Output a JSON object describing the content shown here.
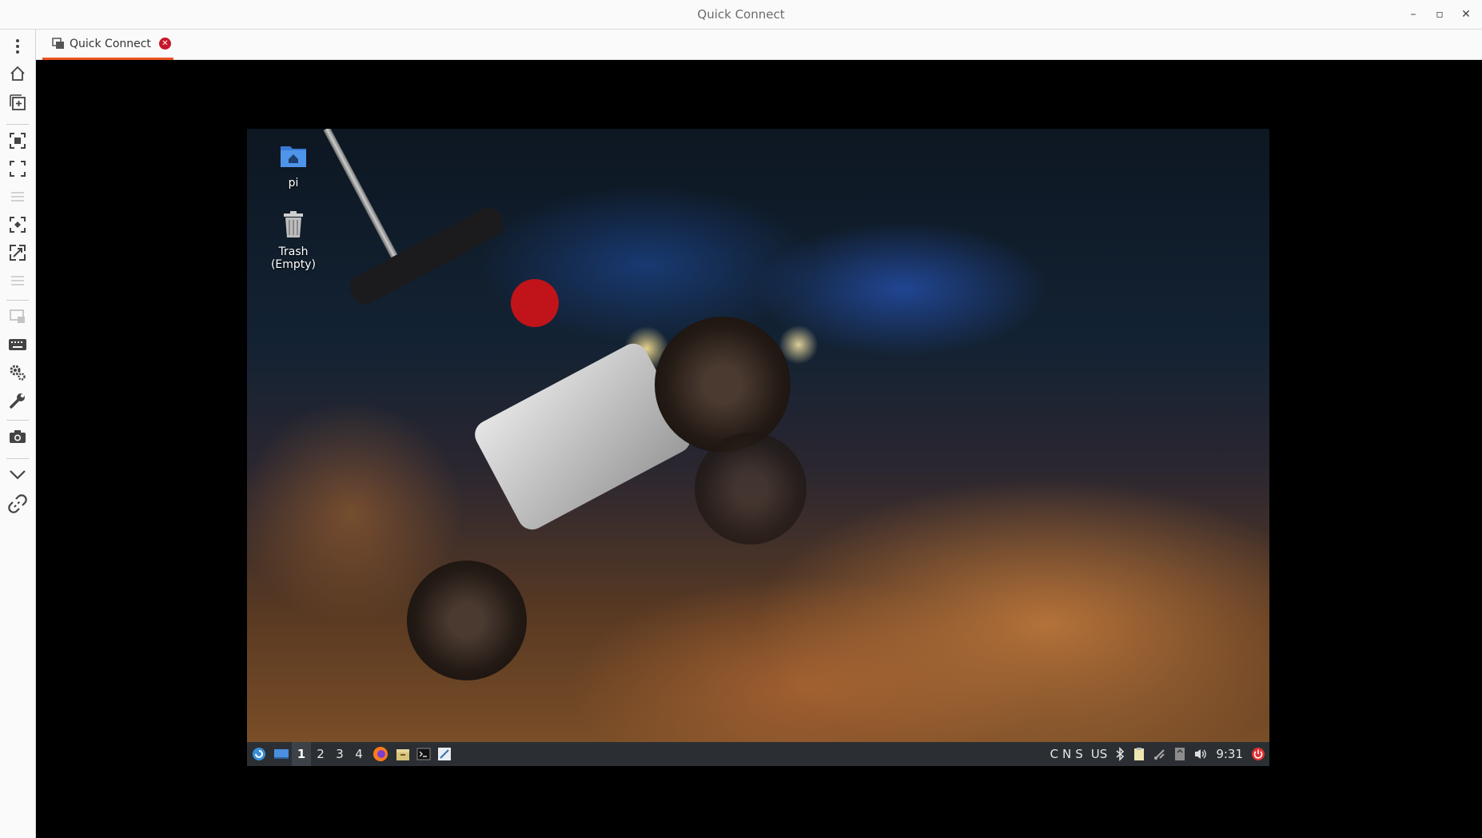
{
  "window": {
    "title": "Quick Connect",
    "minimize_glyph": "–",
    "maximize_glyph": "▫",
    "close_glyph": "✕"
  },
  "toolbar": {
    "items": [
      {
        "name": "menu-dots-icon"
      },
      {
        "name": "home-icon"
      },
      {
        "name": "new-connection-icon"
      },
      {
        "name": "fit-window-icon"
      },
      {
        "name": "fullscreen-icon"
      },
      {
        "name": "scale-icon"
      },
      {
        "name": "scale-to-fit-icon"
      },
      {
        "name": "multi-monitor-icon"
      },
      {
        "name": "keyboard-icon"
      },
      {
        "name": "preferences-icon"
      },
      {
        "name": "tools-icon"
      },
      {
        "name": "screenshot-icon"
      },
      {
        "name": "minimize-toolbar-icon"
      },
      {
        "name": "disconnect-icon"
      }
    ]
  },
  "tabs": [
    {
      "label": "Quick Connect",
      "icon": "remote-desktop-icon",
      "close_glyph": "✕",
      "accent": "#e95420",
      "close_color": "#c7162b"
    }
  ],
  "remote_desktop": {
    "icons": [
      {
        "label": "pi",
        "icon": "home-folder-icon"
      },
      {
        "label": "Trash\n(Empty)",
        "line1": "Trash",
        "line2": "(Empty)",
        "icon": "trash-icon"
      }
    ],
    "taskbar": {
      "menu_icon": "raspberry-menu-icon",
      "show_desktop_icon": "show-desktop-icon",
      "workspaces": [
        "1",
        "2",
        "3",
        "4"
      ],
      "active_workspace": "1",
      "launchers": [
        "firefox-icon",
        "file-manager-icon",
        "terminal-icon",
        "text-editor-icon"
      ],
      "indicators": [
        "C",
        "N",
        "S"
      ],
      "keyboard_layout": "US",
      "tray_icons": [
        "bluetooth-icon",
        "clipboard-icon",
        "network-icon",
        "removable-media-icon",
        "volume-icon"
      ],
      "clock": "9:31",
      "power_icon": "power-icon",
      "power_color": "#e03030"
    }
  }
}
